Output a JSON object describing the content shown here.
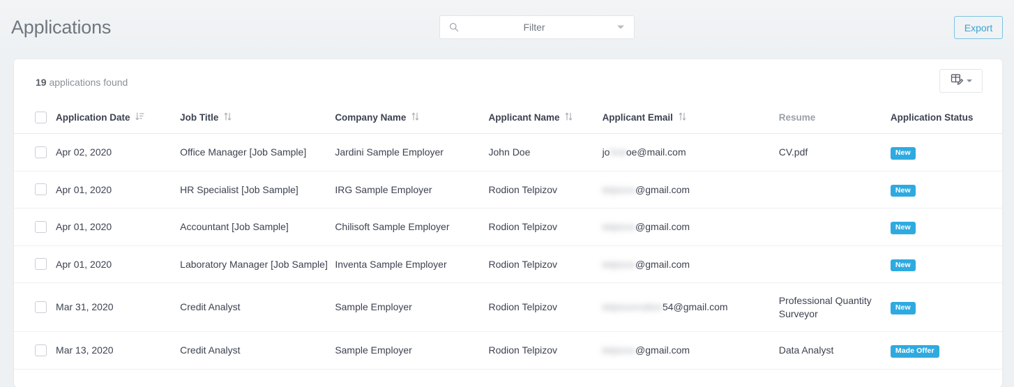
{
  "header": {
    "title": "Applications",
    "filter": {
      "label": "Filter",
      "icon": "search-icon",
      "caret": "chevron-down-icon"
    },
    "export_label": "Export"
  },
  "card": {
    "count_number": "19",
    "count_suffix": " applications found",
    "columns_button": {
      "icon": "table-edit-icon",
      "caret": "chevron-down-icon"
    }
  },
  "table": {
    "columns": [
      {
        "key": "check",
        "label": "",
        "sort": "none"
      },
      {
        "key": "date",
        "label": "Application Date",
        "sort": "desc"
      },
      {
        "key": "job",
        "label": "Job Title",
        "sort": "both"
      },
      {
        "key": "company",
        "label": "Company Name",
        "sort": "both"
      },
      {
        "key": "applicant",
        "label": "Applicant Name",
        "sort": "both"
      },
      {
        "key": "email",
        "label": "Applicant Email",
        "sort": "both"
      },
      {
        "key": "resume",
        "label": "Resume",
        "sort": "none"
      },
      {
        "key": "status",
        "label": "Application Status",
        "sort": "none"
      }
    ],
    "rows": [
      {
        "date": "Apr 02, 2020",
        "job": "Office Manager [Job Sample]",
        "company": "Jardini Sample Employer",
        "applicant": "John Doe",
        "email_redacted": "jo",
        "email_blur": "hnd",
        "email_visible": "oe@mail.com",
        "resume": "CV.pdf",
        "status": "New"
      },
      {
        "date": "Apr 01, 2020",
        "job": "HR Specialist [Job Sample]",
        "company": "IRG Sample Employer",
        "applicant": "Rodion Telpizov",
        "email_redacted": "",
        "email_blur": "telpizov",
        "email_visible": "@gmail.com",
        "resume": "",
        "status": "New"
      },
      {
        "date": "Apr 01, 2020",
        "job": "Accountant [Job Sample]",
        "company": "Chilisoft Sample Employer",
        "applicant": "Rodion Telpizov",
        "email_redacted": "",
        "email_blur": "telpizov",
        "email_visible": "@gmail.com",
        "resume": "",
        "status": "New"
      },
      {
        "date": "Apr 01, 2020",
        "job": "Laboratory Manager [Job Sample]",
        "company": "Inventa Sample Employer",
        "applicant": "Rodion Telpizov",
        "email_redacted": "",
        "email_blur": "telpizov",
        "email_visible": "@gmail.com",
        "resume": "",
        "status": "New"
      },
      {
        "date": "Mar 31, 2020",
        "job": "Credit Analyst",
        "company": "Sample Employer",
        "applicant": "Rodion Telpizov",
        "email_redacted": "",
        "email_blur": "telpizovrodion",
        "email_visible": "54@gmail.com",
        "resume": "Professional Quantity Surveyor",
        "status": "New"
      },
      {
        "date": "Mar 13, 2020",
        "job": "Credit Analyst",
        "company": "Sample Employer",
        "applicant": "Rodion Telpizov",
        "email_redacted": "",
        "email_blur": "telpizov",
        "email_visible": "@gmail.com",
        "resume": "Data Analyst",
        "status": "Made Offer"
      }
    ]
  },
  "colors": {
    "accent": "#2eaae0",
    "export_border": "#7cc3e0",
    "page_bg": "#eef1f3",
    "card_bg": "#ffffff",
    "text_dark": "#3c4250",
    "text_muted": "#8a9099"
  }
}
